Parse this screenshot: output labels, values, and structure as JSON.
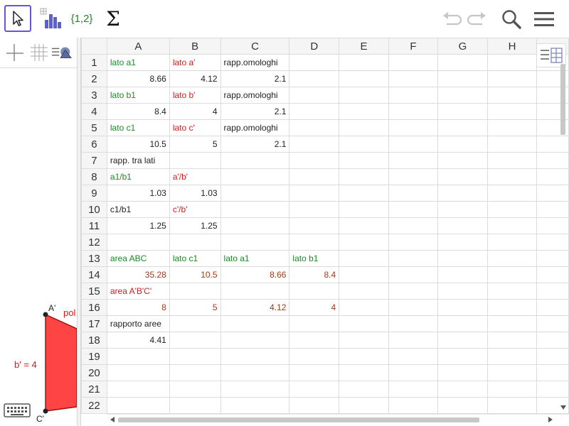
{
  "toolbar": {
    "set_label": "{1,2}",
    "sigma_label": "Σ"
  },
  "graphics": {
    "point_a_label": "A'",
    "point_c_label": "C'",
    "poly_label": "pol",
    "b_label": "b' = 4",
    "poly_color": "#ff4444"
  },
  "sheet": {
    "columns": [
      "A",
      "B",
      "C",
      "D",
      "E",
      "F",
      "G",
      "H"
    ],
    "rows": [
      {
        "n": "1",
        "cells": [
          {
            "t": "lato a1",
            "c": "green"
          },
          {
            "t": "lato a'",
            "c": "red"
          },
          {
            "t": "rapp.omologhi",
            "c": "black"
          },
          {
            "t": ""
          }
        ]
      },
      {
        "n": "2",
        "cells": [
          {
            "t": "8.66",
            "c": "black",
            "num": true
          },
          {
            "t": "4.12",
            "c": "black",
            "num": true
          },
          {
            "t": "2.1",
            "c": "black",
            "num": true
          },
          {
            "t": ""
          }
        ]
      },
      {
        "n": "3",
        "cells": [
          {
            "t": "lato b1",
            "c": "green"
          },
          {
            "t": "lato b'",
            "c": "red"
          },
          {
            "t": "rapp.omologhi",
            "c": "black"
          },
          {
            "t": ""
          }
        ]
      },
      {
        "n": "4",
        "cells": [
          {
            "t": "8.4",
            "c": "black",
            "num": true
          },
          {
            "t": "4",
            "c": "black",
            "num": true
          },
          {
            "t": "2.1",
            "c": "black",
            "num": true
          },
          {
            "t": ""
          }
        ]
      },
      {
        "n": "5",
        "cells": [
          {
            "t": "lato c1",
            "c": "green"
          },
          {
            "t": "lato c'",
            "c": "red"
          },
          {
            "t": "rapp.omologhi",
            "c": "black"
          },
          {
            "t": ""
          }
        ]
      },
      {
        "n": "6",
        "cells": [
          {
            "t": "10.5",
            "c": "black",
            "num": true
          },
          {
            "t": "5",
            "c": "black",
            "num": true
          },
          {
            "t": "2.1",
            "c": "black",
            "num": true
          },
          {
            "t": ""
          }
        ]
      },
      {
        "n": "7",
        "cells": [
          {
            "t": "rapp. tra lati",
            "c": "black"
          },
          {
            "t": ""
          },
          {
            "t": ""
          },
          {
            "t": ""
          }
        ]
      },
      {
        "n": "8",
        "cells": [
          {
            "t": "a1/b1",
            "c": "green"
          },
          {
            "t": "a'/b'",
            "c": "red"
          },
          {
            "t": ""
          },
          {
            "t": ""
          }
        ]
      },
      {
        "n": "9",
        "cells": [
          {
            "t": "1.03",
            "c": "black",
            "num": true
          },
          {
            "t": "1.03",
            "c": "black",
            "num": true
          },
          {
            "t": ""
          },
          {
            "t": ""
          }
        ]
      },
      {
        "n": "10",
        "cells": [
          {
            "t": "c1/b1",
            "c": "black"
          },
          {
            "t": "c'/b'",
            "c": "red"
          },
          {
            "t": ""
          },
          {
            "t": ""
          }
        ]
      },
      {
        "n": "11",
        "cells": [
          {
            "t": "1.25",
            "c": "black",
            "num": true
          },
          {
            "t": "1.25",
            "c": "black",
            "num": true
          },
          {
            "t": ""
          },
          {
            "t": ""
          }
        ]
      },
      {
        "n": "12",
        "cells": [
          {
            "t": ""
          },
          {
            "t": ""
          },
          {
            "t": ""
          },
          {
            "t": ""
          }
        ]
      },
      {
        "n": "13",
        "cells": [
          {
            "t": "area ABC",
            "c": "green"
          },
          {
            "t": "lato c1",
            "c": "green"
          },
          {
            "t": "lato a1",
            "c": "green"
          },
          {
            "t": "lato b1",
            "c": "green"
          }
        ]
      },
      {
        "n": "14",
        "cells": [
          {
            "t": "35.28",
            "c": "brown",
            "num": true
          },
          {
            "t": "10.5",
            "c": "brown",
            "num": true
          },
          {
            "t": "8.66",
            "c": "brown",
            "num": true
          },
          {
            "t": "8.4",
            "c": "brown",
            "num": true
          }
        ]
      },
      {
        "n": "15",
        "cells": [
          {
            "t": "area A'B'C'",
            "c": "red"
          },
          {
            "t": ""
          },
          {
            "t": ""
          },
          {
            "t": ""
          }
        ]
      },
      {
        "n": "16",
        "cells": [
          {
            "t": "8",
            "c": "brown",
            "num": true
          },
          {
            "t": "5",
            "c": "brown",
            "num": true
          },
          {
            "t": "4.12",
            "c": "brown",
            "num": true
          },
          {
            "t": "4",
            "c": "brown",
            "num": true
          }
        ]
      },
      {
        "n": "17",
        "cells": [
          {
            "t": "rapporto aree",
            "c": "black"
          },
          {
            "t": ""
          },
          {
            "t": ""
          },
          {
            "t": ""
          }
        ]
      },
      {
        "n": "18",
        "cells": [
          {
            "t": "4.41",
            "c": "black",
            "num": true
          },
          {
            "t": ""
          },
          {
            "t": ""
          },
          {
            "t": ""
          }
        ]
      },
      {
        "n": "19",
        "cells": [
          {
            "t": ""
          },
          {
            "t": ""
          },
          {
            "t": ""
          },
          {
            "t": ""
          }
        ]
      },
      {
        "n": "20",
        "cells": [
          {
            "t": ""
          },
          {
            "t": ""
          },
          {
            "t": ""
          },
          {
            "t": ""
          }
        ]
      },
      {
        "n": "21",
        "cells": [
          {
            "t": ""
          },
          {
            "t": ""
          },
          {
            "t": ""
          },
          {
            "t": ""
          }
        ]
      },
      {
        "n": "22",
        "cells": [
          {
            "t": ""
          },
          {
            "t": ""
          },
          {
            "t": ""
          },
          {
            "t": ""
          }
        ]
      }
    ]
  },
  "colors": {
    "selected_tool_border": "#6557d2",
    "green_text": "#1b8a25",
    "red_text": "#d41c1c",
    "brown_text": "#a33a1a"
  }
}
